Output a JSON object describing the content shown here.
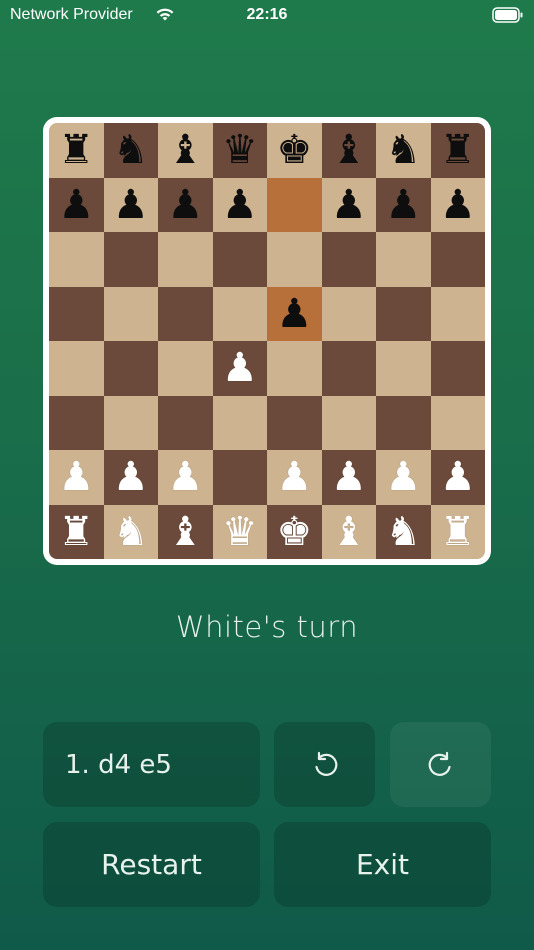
{
  "status_bar": {
    "carrier": "Network Provider",
    "time": "22:16"
  },
  "board": {
    "highlight_squares": [
      "e7",
      "e5"
    ],
    "colors": {
      "light": "#cdb390",
      "dark": "#6b4a3b",
      "highlight": "#b8703a"
    },
    "ranks": [
      [
        "br",
        "bn",
        "bb",
        "bq",
        "bk",
        "bb",
        "bn",
        "br"
      ],
      [
        "bp",
        "bp",
        "bp",
        "bp",
        "",
        "bp",
        "bp",
        "bp"
      ],
      [
        "",
        "",
        "",
        "",
        "",
        "",
        "",
        ""
      ],
      [
        "",
        "",
        "",
        "",
        "bp",
        "",
        "",
        ""
      ],
      [
        "",
        "",
        "",
        "wp",
        "",
        "",
        "",
        ""
      ],
      [
        "",
        "",
        "",
        "",
        "",
        "",
        "",
        ""
      ],
      [
        "wp",
        "wp",
        "wp",
        "",
        "wp",
        "wp",
        "wp",
        "wp"
      ],
      [
        "wr",
        "wn",
        "wb",
        "wq",
        "wk",
        "wb",
        "wn",
        "wr"
      ]
    ]
  },
  "turn_label": "White's turn",
  "controls": {
    "moves_label": "1. d4 e5",
    "undo_icon": "undo-icon",
    "redo_icon": "redo-icon",
    "restart_label": "Restart",
    "exit_label": "Exit"
  }
}
